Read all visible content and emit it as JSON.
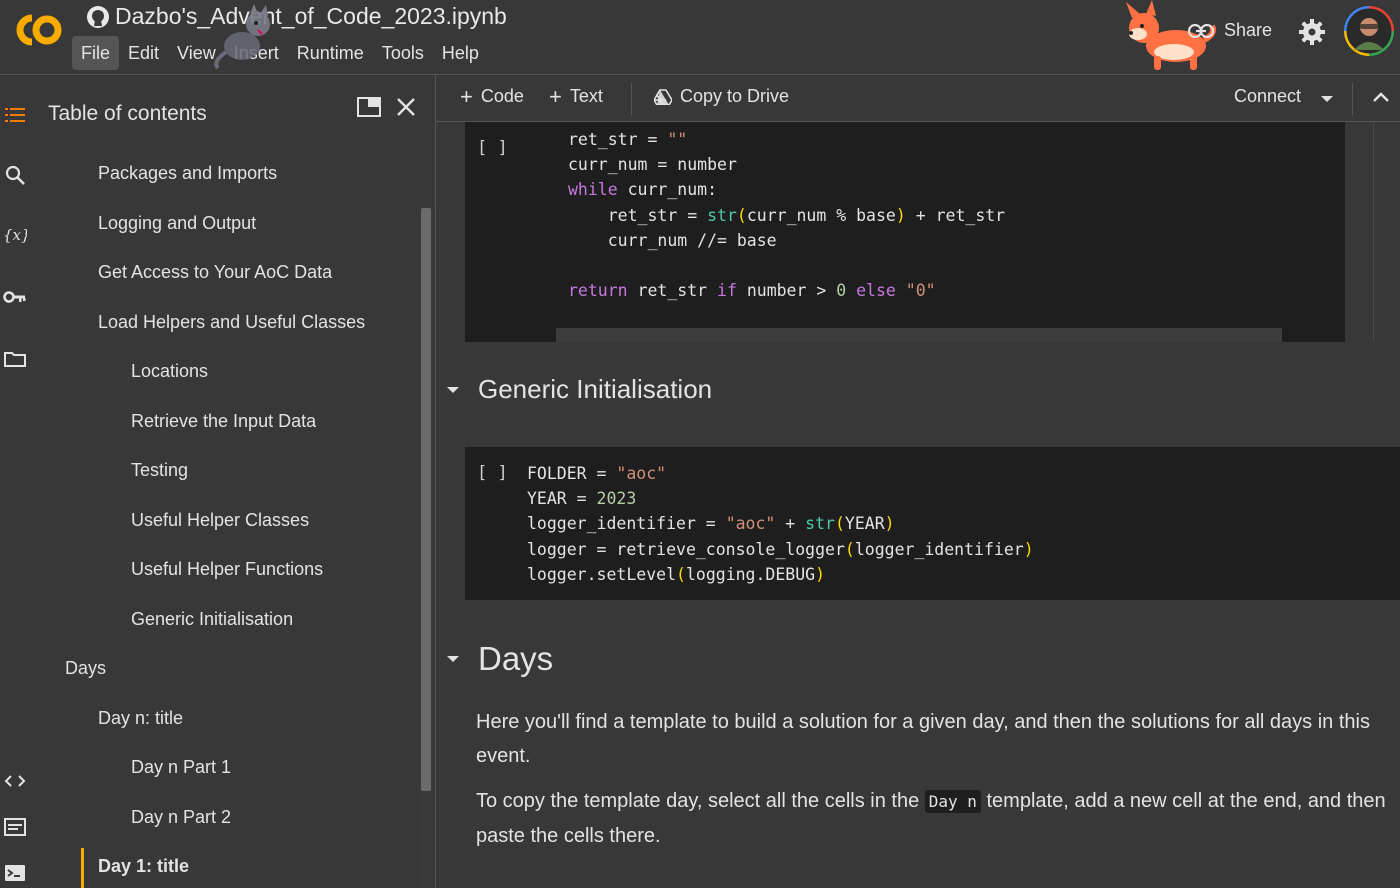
{
  "header": {
    "logo_text": "CO",
    "title": "Dazbo's_Advent_of_Code_2023.ipynb",
    "share_label": "Share",
    "menu": [
      "File",
      "Edit",
      "View",
      "Insert",
      "Runtime",
      "Tools",
      "Help"
    ],
    "active_menu": "File"
  },
  "rail": {
    "icons": [
      "toc-icon",
      "search-icon",
      "variables-icon",
      "key-icon",
      "folder-icon",
      "code-snippets-icon",
      "command-palette-icon",
      "terminal-icon"
    ]
  },
  "toc": {
    "title": "Table of contents",
    "items": [
      {
        "label": "Packages and Imports",
        "level": 2
      },
      {
        "label": "Logging and Output",
        "level": 2
      },
      {
        "label": "Get Access to Your AoC Data",
        "level": 2
      },
      {
        "label": "Load Helpers and Useful Classes",
        "level": 2
      },
      {
        "label": "Locations",
        "level": 3
      },
      {
        "label": "Retrieve the Input Data",
        "level": 3
      },
      {
        "label": "Testing",
        "level": 3
      },
      {
        "label": "Useful Helper Classes",
        "level": 3
      },
      {
        "label": "Useful Helper Functions",
        "level": 3
      },
      {
        "label": "Generic Initialisation",
        "level": 3
      },
      {
        "label": "Days",
        "level": 1
      },
      {
        "label": "Day n: title",
        "level": 2
      },
      {
        "label": "Day n Part 1",
        "level": 3
      },
      {
        "label": "Day n Part 2",
        "level": 3
      },
      {
        "label": "Day 1: title",
        "level": 2,
        "current": true
      }
    ]
  },
  "toolbar": {
    "add_code": "Code",
    "add_text": "Text",
    "copy_to_drive": "Copy to Drive",
    "connect": "Connect"
  },
  "cells": {
    "cell1": {
      "bracket": "[ ]",
      "lines": [
        "ret_str = \"\"",
        "curr_num = number",
        "while curr_num:",
        "    ret_str = str(curr_num % base) + ret_str",
        "    curr_num //= base",
        "",
        "return ret_str if number > 0 else \"0\""
      ]
    },
    "section1": {
      "title": "Generic Initialisation"
    },
    "cell2": {
      "bracket": "[ ]",
      "lines": [
        "FOLDER = \"aoc\"",
        "YEAR = 2023",
        "logger_identifier = \"aoc\" + str(YEAR)",
        "logger = retrieve_console_logger(logger_identifier)",
        "logger.setLevel(logging.DEBUG)"
      ]
    },
    "section2": {
      "title": "Days",
      "para1": "Here you'll find a template to build a solution for a given day, and then the solutions for all days in this event.",
      "para2_before": "To copy the template day, select all the cells in the ",
      "para2_code": "Day n",
      "para2_after": " template, add a new cell at the end, and then paste the cells there."
    }
  },
  "colors": {
    "background": "#383838",
    "code_bg": "#1e1e1e",
    "accent": "#f9ab00",
    "logo_orange": "#f9ab00",
    "keyword": "#c678dd",
    "string": "#ce9178",
    "builtin": "#4ec9b0"
  }
}
